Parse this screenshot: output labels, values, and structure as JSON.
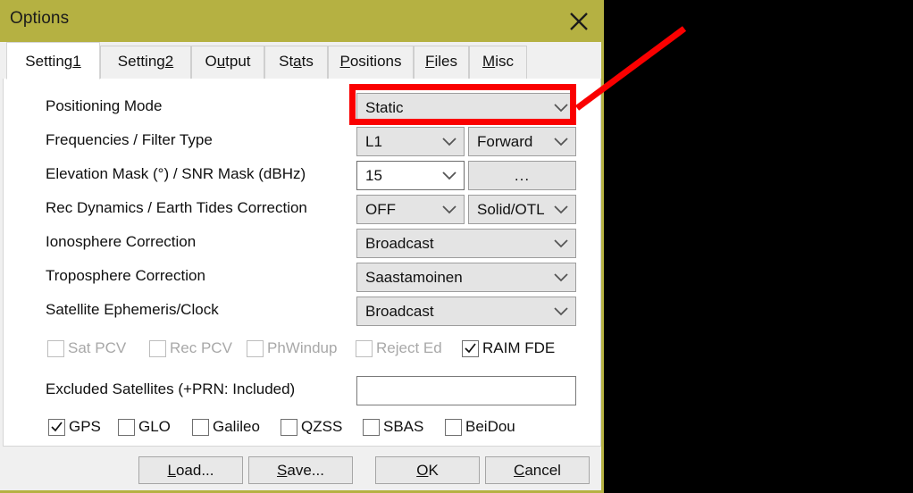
{
  "window": {
    "title": "Options",
    "close_icon": "close-icon"
  },
  "tabs": [
    {
      "label": "Setting1",
      "mnemonic": "1",
      "active": true
    },
    {
      "label": "Setting2",
      "mnemonic": "2",
      "active": false
    },
    {
      "label": "Output",
      "mnemonic": "u",
      "active": false
    },
    {
      "label": "Stats",
      "mnemonic": "a",
      "active": false
    },
    {
      "label": "Positions",
      "mnemonic": "P",
      "active": false
    },
    {
      "label": "Files",
      "mnemonic": "F",
      "active": false
    },
    {
      "label": "Misc",
      "mnemonic": "M",
      "active": false
    }
  ],
  "form": {
    "positioning_mode": {
      "label": "Positioning Mode",
      "value": "Static",
      "highlighted": true
    },
    "frequencies_filter": {
      "label": "Frequencies / Filter Type",
      "frequencies": "L1",
      "filter_type": "Forward"
    },
    "elevation_snr": {
      "label": "Elevation Mask (°) / SNR Mask (dBHz)",
      "elevation_mask": "15",
      "snr_mask_button": "..."
    },
    "rec_dynamics_tides": {
      "label": "Rec Dynamics / Earth Tides Correction",
      "rec_dynamics": "OFF",
      "earth_tides": "Solid/OTL"
    },
    "ionosphere": {
      "label": "Ionosphere Correction",
      "value": "Broadcast"
    },
    "troposphere": {
      "label": "Troposphere Correction",
      "value": "Saastamoinen"
    },
    "satellite_ephemeris": {
      "label": "Satellite Ephemeris/Clock",
      "value": "Broadcast"
    },
    "correction_checkboxes": [
      {
        "label": "Sat PCV",
        "checked": false,
        "disabled": true
      },
      {
        "label": "Rec PCV",
        "checked": false,
        "disabled": true
      },
      {
        "label": "PhWindup",
        "checked": false,
        "disabled": true
      },
      {
        "label": "Reject Ed",
        "checked": false,
        "disabled": true
      },
      {
        "label": "RAIM FDE",
        "checked": true,
        "disabled": false
      }
    ],
    "excluded_satellites": {
      "label": "Excluded Satellites (+PRN: Included)",
      "value": "",
      "placeholder": ""
    },
    "constellations": [
      {
        "label": "GPS",
        "checked": true
      },
      {
        "label": "GLO",
        "checked": false
      },
      {
        "label": "Galileo",
        "checked": false
      },
      {
        "label": "QZSS",
        "checked": false
      },
      {
        "label": "SBAS",
        "checked": false
      },
      {
        "label": "BeiDou",
        "checked": false
      }
    ]
  },
  "footer_buttons": [
    {
      "label": "Load...",
      "mnemonic": "L"
    },
    {
      "label": "Save...",
      "mnemonic": "S"
    },
    {
      "label": "OK",
      "mnemonic": "O"
    },
    {
      "label": "Cancel",
      "mnemonic": "C"
    }
  ],
  "annotation": {
    "highlight_color": "#fa0000",
    "arrow_color": "#fa0000",
    "target": "positioning-mode-combo"
  },
  "colors": {
    "titlebar": "#b5b142",
    "dialog_face": "#f0f0f0",
    "panel": "#ffffff",
    "control_face": "#e4e4e4",
    "text": "#101010",
    "disabled_text": "#a8a8a8"
  }
}
